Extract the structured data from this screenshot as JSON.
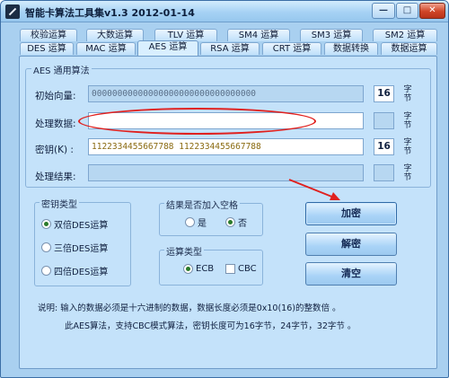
{
  "window": {
    "title": "智能卡算法工具集v1.3 2012-01-14",
    "controls": {
      "minimize": "—",
      "maximize": "□",
      "close": "✕"
    }
  },
  "tabs_row1": [
    "校验运算",
    "大数运算",
    "TLV 运算",
    "SM4 运算",
    "SM3 运算",
    "SM2 运算"
  ],
  "tabs_row2": [
    "DES 运算",
    "MAC 运算",
    "AES 运算",
    "RSA 运算",
    "CRT 运算",
    "数据转换",
    "数据运算"
  ],
  "active_tab": "AES 运算",
  "aes_group": {
    "title": "AES 通用算法",
    "rows": [
      {
        "label": "初始向量:",
        "value": "00000000000000000000000000000000",
        "count": "16",
        "unit": "字节"
      },
      {
        "label": "处理数据:",
        "value": "",
        "count": "",
        "unit": "字节"
      },
      {
        "label": "密钥(K)  :",
        "value": "1122334455667788 1122334455667788",
        "count": "16",
        "unit": "字节"
      },
      {
        "label": "处理结果:",
        "value": "",
        "count": "",
        "unit": "字节"
      }
    ]
  },
  "key_type": {
    "title": "密钥类型",
    "options": [
      "双倍DES运算",
      "三倍DES运算",
      "四倍DES运算"
    ],
    "selected": "双倍DES运算"
  },
  "add_space": {
    "title": "结果是否加入空格",
    "options": [
      "是",
      "否"
    ],
    "selected": "否"
  },
  "op_type": {
    "title": "运算类型",
    "options": [
      "ECB",
      "CBC"
    ],
    "selected": "ECB"
  },
  "buttons": {
    "encrypt": "加密",
    "decrypt": "解密",
    "clear": "清空"
  },
  "notes": [
    "说明: 输入的数据必须是十六进制的数据，数据长度必须是0x10(16)的整数倍 。",
    "此AES算法，支持CBC模式算法，密钥长度可为16字节，24字节，32字节 。"
  ],
  "colors": {
    "annotation": "#e0211f",
    "window_bg": "#a9d0f0",
    "panel_bg": "#c4e2fa"
  }
}
